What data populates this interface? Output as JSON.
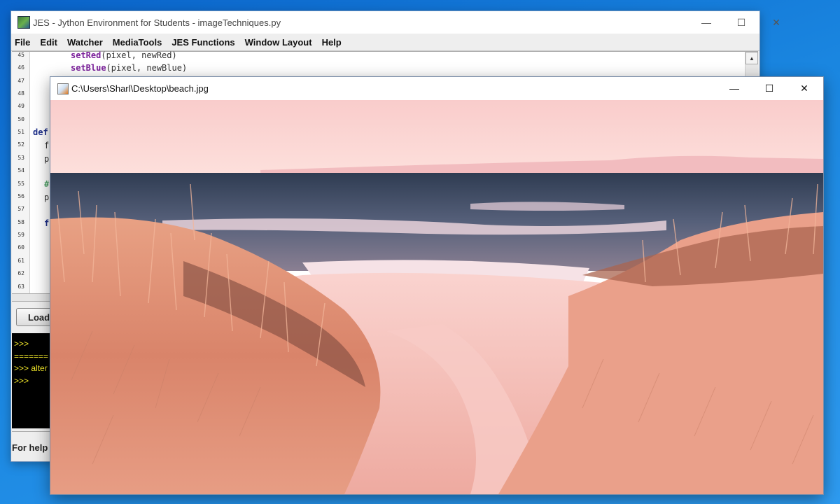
{
  "jes": {
    "title": "JES - Jython Environment for Students - imageTechniques.py",
    "menu": [
      "File",
      "Edit",
      "Watcher",
      "MediaTools",
      "JES Functions",
      "Window Layout",
      "Help"
    ],
    "line_numbers": [
      "45",
      "46",
      "47",
      "48",
      "49",
      "50",
      "51",
      "52",
      "53",
      "54",
      "55",
      "56",
      "57",
      "58",
      "59",
      "60",
      "61",
      "62",
      "63"
    ],
    "code": {
      "l45_fn": "setRed",
      "l45_args": "(pixel, newRed)",
      "l46_fn": "setBlue",
      "l46_args": "(pixel, newBlue)",
      "l51_kw": "def",
      "l52": "f",
      "l53": "p",
      "l55": "#",
      "l56": "p",
      "l58": "f"
    },
    "load_button": "Load",
    "console": [
      ">>>",
      "=======",
      ">>> alter",
      ">>>"
    ],
    "status": "For help c"
  },
  "picture": {
    "title": "C:\\Users\\Sharl\\Desktop\\beach.jpg"
  },
  "colors": {
    "desktop": "#1a86e0",
    "console_text": "#f4ea2a",
    "keyword": "#7a1f9a",
    "sky": "#fbd3d1",
    "sea": "#3d4f63",
    "grass": "#e39a7b",
    "sand": "#f6c5c0"
  }
}
